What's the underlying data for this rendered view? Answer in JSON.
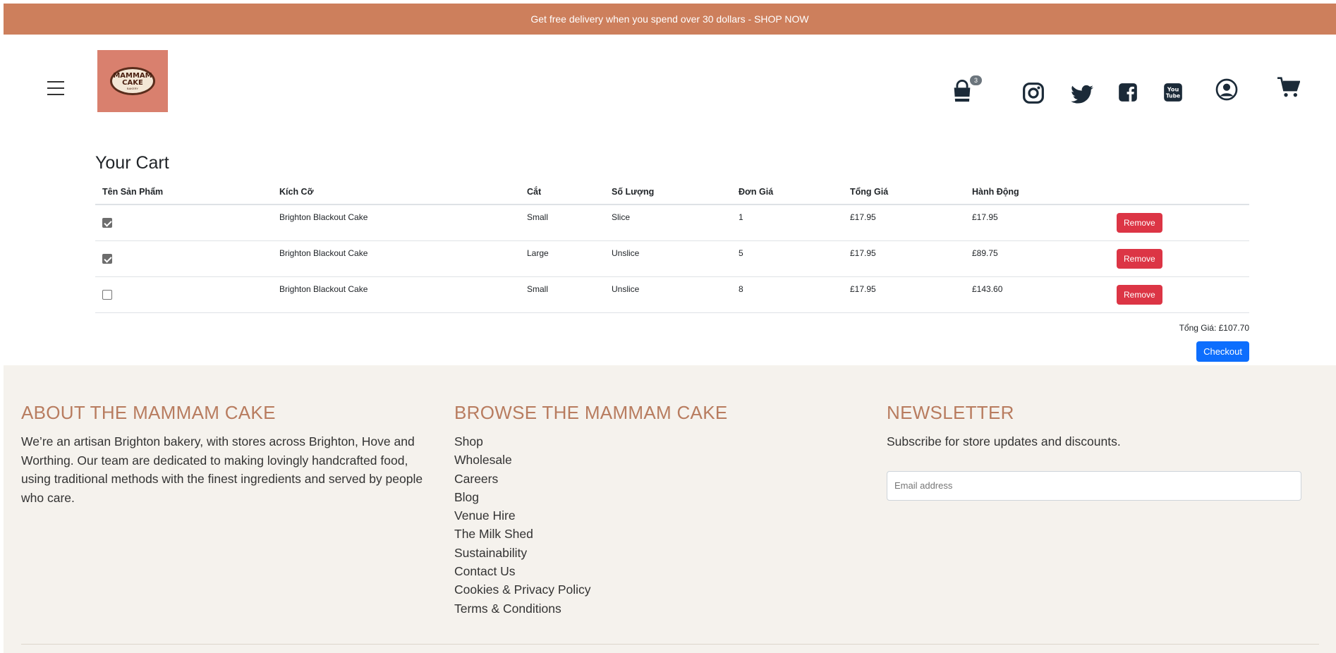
{
  "promo": {
    "text": "Get free delivery when you spend over 30 dollars - SHOP NOW"
  },
  "logo": {
    "line1": "MAMMAM",
    "line2": "CAKE",
    "tag": "BAKERY"
  },
  "bag": {
    "count": "3"
  },
  "icons": [
    "menu-icon",
    "shopping-bag-icon",
    "instagram-icon",
    "twitter-icon",
    "facebook-icon",
    "youtube-icon",
    "user-icon",
    "cart-icon"
  ],
  "cart": {
    "title": "Your Cart",
    "headers": [
      "Tên Sản Phẩm",
      "Kích Cỡ",
      "Cắt",
      "Số Lượng",
      "Đơn Giá",
      "Tổng Giá",
      "Hành Động"
    ],
    "rows": [
      {
        "checked": true,
        "name": "Brighton Blackout Cake",
        "size": "Small",
        "cut": "Slice",
        "qty": "1",
        "unit": "£17.95",
        "total": "£17.95",
        "action": "Remove"
      },
      {
        "checked": true,
        "name": "Brighton Blackout Cake",
        "size": "Large",
        "cut": "Unslice",
        "qty": "5",
        "unit": "£17.95",
        "total": "£89.75",
        "action": "Remove"
      },
      {
        "checked": false,
        "name": "Brighton Blackout Cake",
        "size": "Small",
        "cut": "Unslice",
        "qty": "8",
        "unit": "£17.95",
        "total": "£143.60",
        "action": "Remove"
      }
    ],
    "grand_total": "Tổng Giá: £107.70",
    "checkout": "Checkout"
  },
  "footer": {
    "about": {
      "title": "ABOUT THE MAMMAM CAKE",
      "text": "We’re an artisan Brighton bakery, with stores across Brighton, Hove and Worthing. Our team are dedicated to making lovingly handcrafted food, using traditional methods with the finest ingredients and served by people who care."
    },
    "browse": {
      "title": "BROWSE THE MAMMAM CAKE",
      "links": [
        "Shop",
        "Wholesale",
        "Careers",
        "Blog",
        "Venue Hire",
        "The Milk Shed",
        "Sustainability",
        "Contact Us",
        "Cookies & Privacy Policy",
        "Terms & Conditions"
      ]
    },
    "newsletter": {
      "title": "NEWSLETTER",
      "text": "Subscribe for store updates and discounts.",
      "placeholder": "Email address"
    }
  },
  "colors": {
    "promo": "#cd7f5c",
    "footer_bg": "#f5f2ed",
    "footer_heading": "#b87c5f",
    "remove": "#dc3545",
    "checkout": "#0d6efd"
  }
}
